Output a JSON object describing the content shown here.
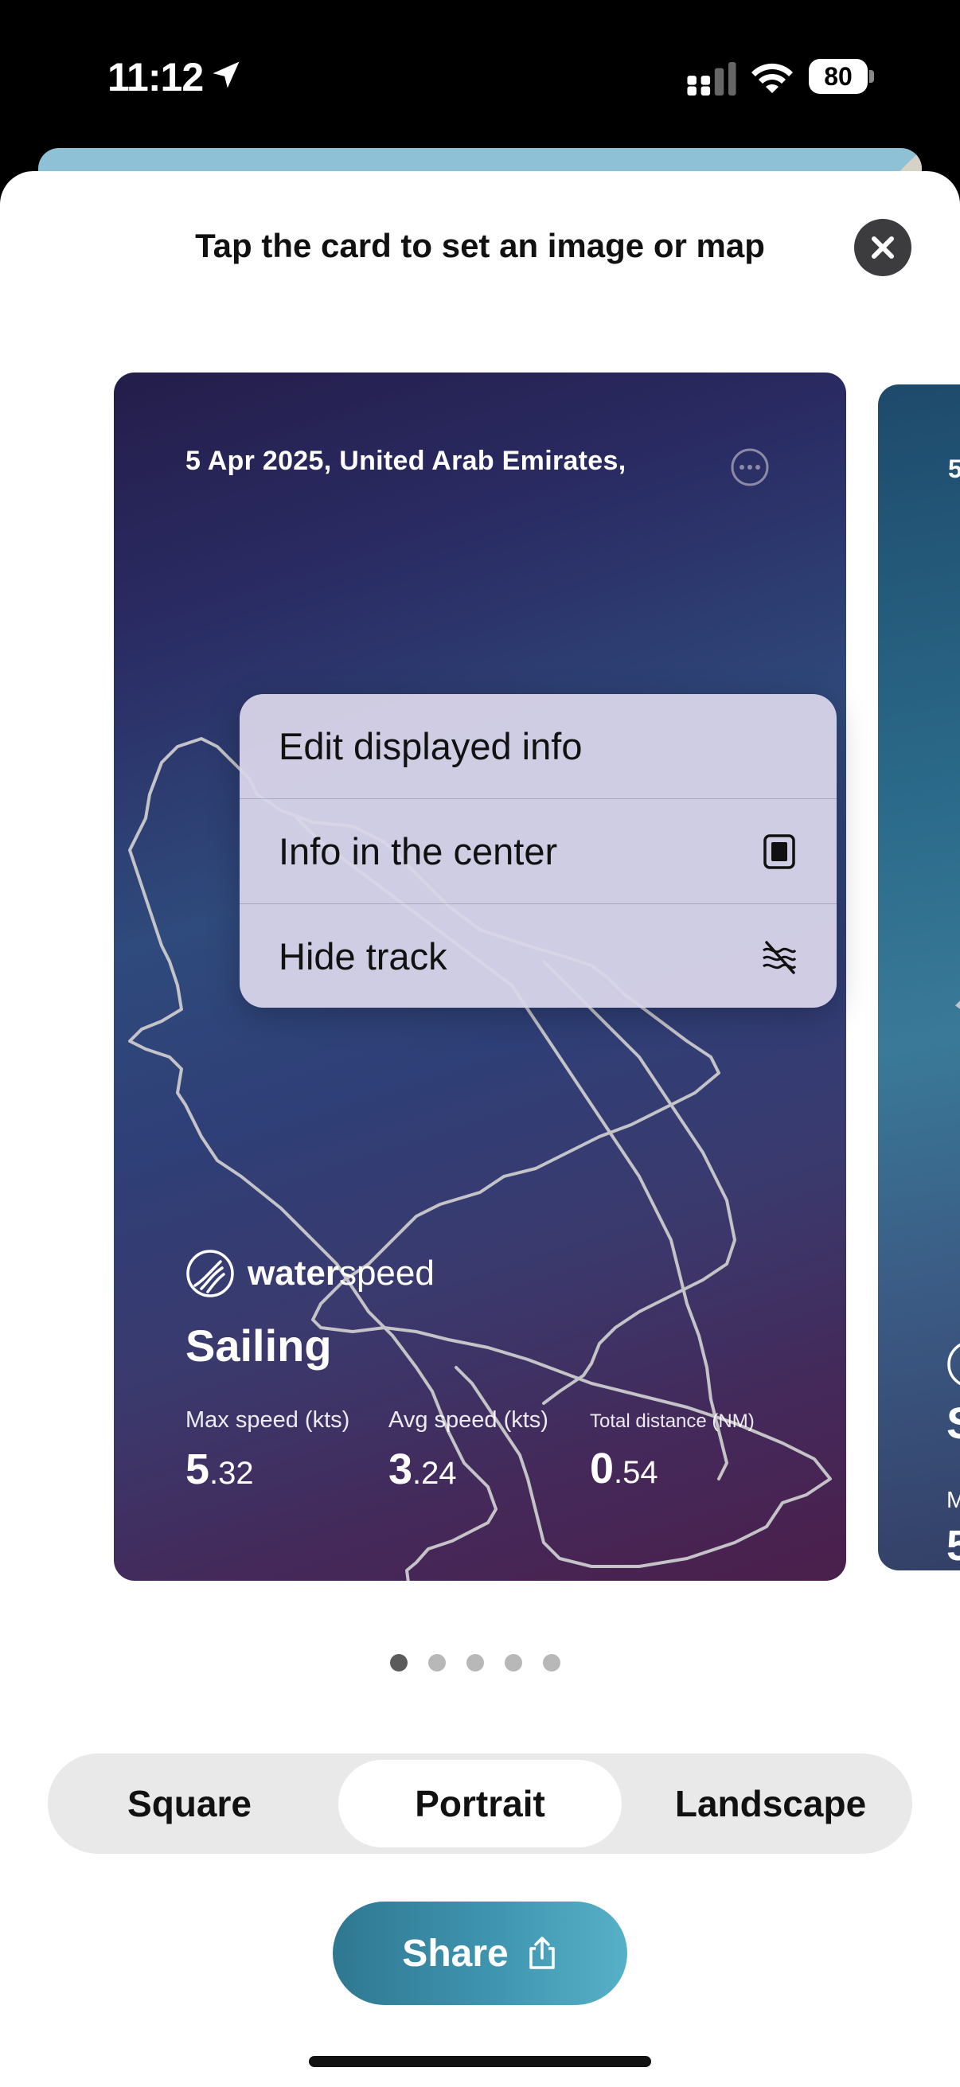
{
  "status_bar": {
    "time": "11:12",
    "battery": "80"
  },
  "sheet": {
    "title": "Tap the card to set an image or map"
  },
  "card": {
    "date_location": "5 Apr 2025, United Arab Emirates,",
    "brand": {
      "bold": "water",
      "regular": "speed"
    },
    "activity": "Sailing",
    "stats": [
      {
        "label": "Max speed (kts)",
        "int": "5",
        "dec": ".32"
      },
      {
        "label": "Avg speed (kts)",
        "int": "3",
        "dec": ".24"
      },
      {
        "label": "Total distance (NM)",
        "int": "0",
        "dec": ".54"
      }
    ]
  },
  "next_card": {
    "frag_date": "5",
    "frag_stat": "5",
    "frag_activity": "S",
    "frag_label": "M"
  },
  "menu": {
    "items": [
      {
        "label": "Edit displayed info",
        "icon": "none"
      },
      {
        "label": "Info in the center",
        "icon": "center-layout-icon"
      },
      {
        "label": "Hide track",
        "icon": "hide-track-icon"
      }
    ]
  },
  "pager": {
    "count": 5,
    "active": 1
  },
  "format": {
    "options": [
      "Square",
      "Portrait",
      "Landscape"
    ],
    "selected": "Portrait"
  },
  "share": {
    "label": "Share"
  },
  "colors": {
    "accent": "#3f95b0",
    "card_top": "#241d4a",
    "card_bottom": "#4b1f4b"
  }
}
